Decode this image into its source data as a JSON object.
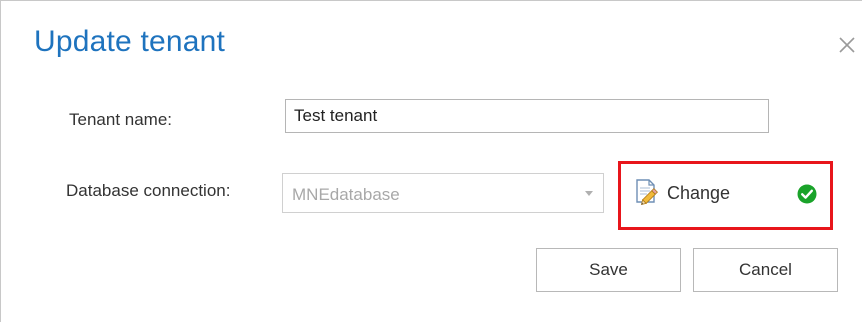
{
  "dialog": {
    "title": "Update tenant",
    "close_icon": "close-icon"
  },
  "form": {
    "tenant_name_label": "Tenant name:",
    "tenant_name_value": "Test tenant",
    "database_connection_label": "Database connection:",
    "database_connection_value": "MNEdatabase",
    "database_connection_disabled": true
  },
  "change": {
    "label": "Change",
    "icon": "edit-pencil-icon",
    "status_icon": "check-circle-icon",
    "status_color": "#1aa32a",
    "highlight_color": "#e8151b"
  },
  "buttons": {
    "save_label": "Save",
    "cancel_label": "Cancel"
  },
  "colors": {
    "title": "#1e73be"
  }
}
